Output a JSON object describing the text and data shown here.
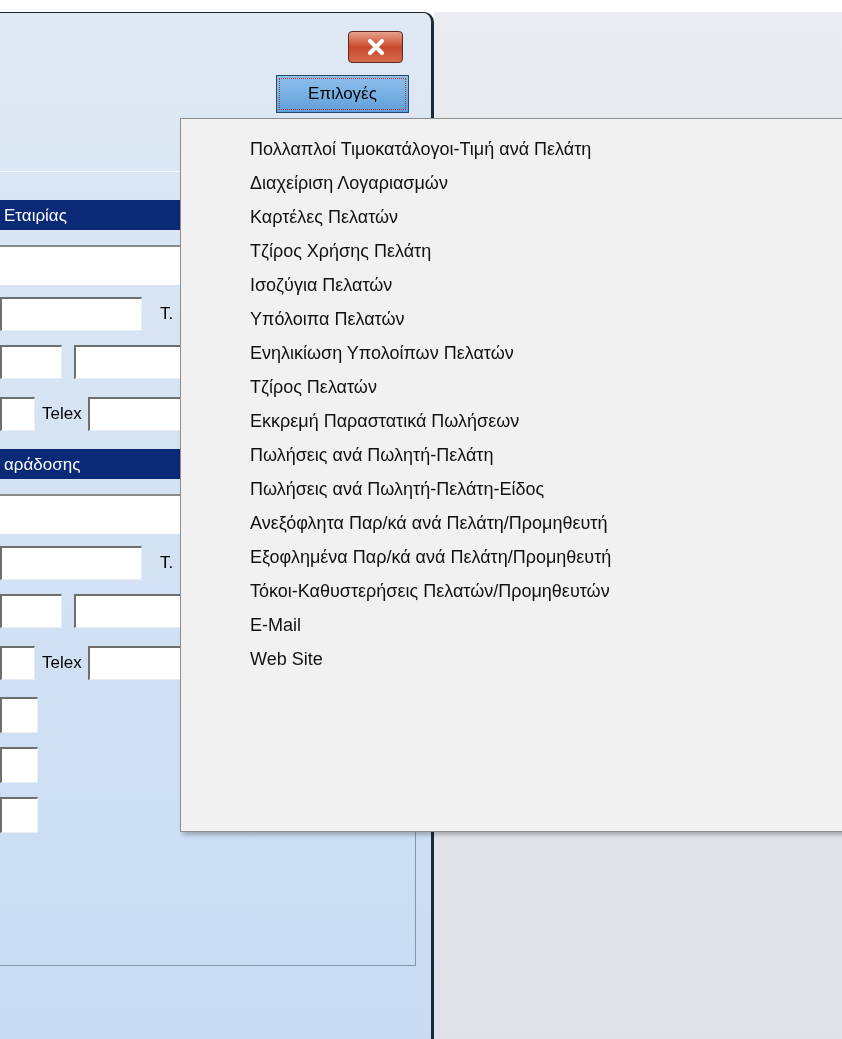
{
  "window": {
    "options_button": {
      "label": "Επιλογές",
      "pressed": true
    }
  },
  "form": {
    "sections": [
      {
        "header": "Εταιρίας",
        "phone_label": "T.",
        "telex_label": "Telex"
      },
      {
        "header": "αράδοσης",
        "phone_label": "T.",
        "telex_label": "Telex"
      }
    ]
  },
  "menu": {
    "items": [
      {
        "label": "Πολλαπλοί Τιμοκατάλογοι-Τιμή ανά Πελάτη"
      },
      {
        "label": "Διαχείριση Λογαριασμών"
      },
      {
        "label": "Καρτέλες Πελατών"
      },
      {
        "label": "Τζίρος Χρήσης Πελάτη"
      },
      {
        "label": "Ισοζύγια Πελατών"
      },
      {
        "label": "Υπόλοιπα Πελατών"
      },
      {
        "label": "Ενηλικίωση Υπολοίπων Πελατών"
      },
      {
        "label": "Τζίρος Πελατών"
      },
      {
        "label": "Εκκρεμή Παραστατικά Πωλήσεων"
      },
      {
        "label": "Πωλήσεις ανά Πωλητή-Πελάτη"
      },
      {
        "label": "Πωλήσεις ανά Πωλητή-Πελάτη-Είδος"
      },
      {
        "label": "Ανεξόφλητα Παρ/κά ανά Πελάτη/Προμηθευτή"
      },
      {
        "label": "Εξοφλημένα Παρ/κά ανά Πελάτη/Προμηθευτή"
      },
      {
        "label": "Τόκοι-Καθυστερήσεις Πελατών/Προμηθευτών"
      },
      {
        "label": "E-Mail"
      },
      {
        "label": "Web Site"
      }
    ]
  }
}
